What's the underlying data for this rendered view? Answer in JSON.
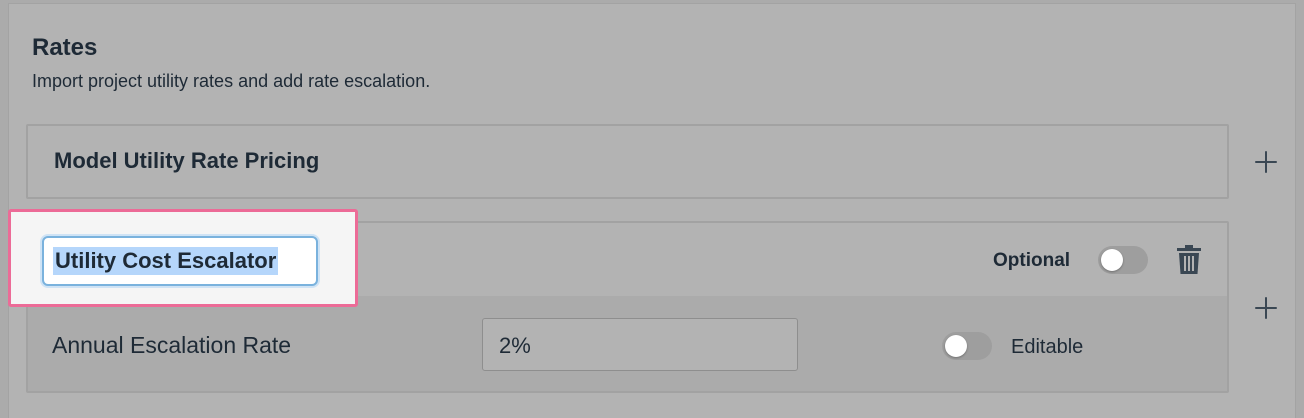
{
  "section": {
    "title": "Rates",
    "subtitle": "Import project utility rates and add rate escalation."
  },
  "cards": [
    {
      "title": "Model Utility Rate Pricing"
    },
    {
      "title_input_value": "Utility Cost Escalator",
      "optional_label": "Optional",
      "optional_toggle_on": false,
      "field": {
        "label": "Annual Escalation Rate",
        "value": "2%",
        "editable_label": "Editable",
        "editable_toggle_on": false
      }
    }
  ],
  "icons": {
    "add": "plus-icon",
    "delete": "trash-icon"
  },
  "colors": {
    "highlight_border": "#ec6b97",
    "text_selection": "#b5d6fb",
    "input_focus_border": "#7ab2dd"
  }
}
